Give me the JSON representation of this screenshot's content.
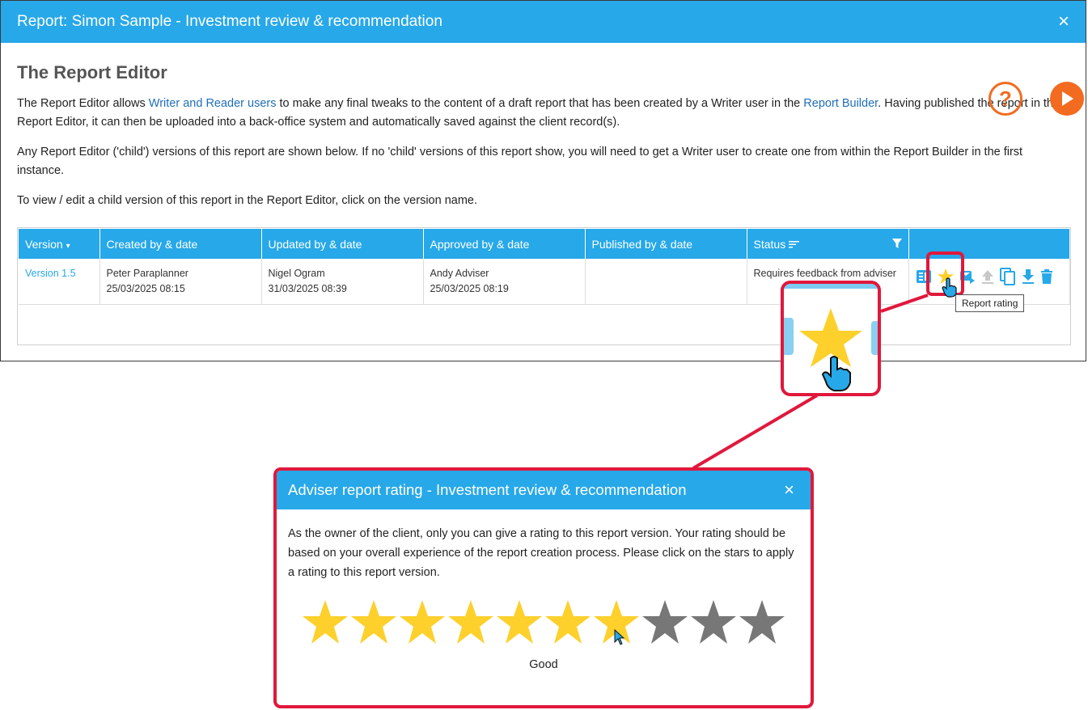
{
  "dialog": {
    "title": "Report: Simon Sample - Investment review & recommendation",
    "close_label": "×"
  },
  "editor": {
    "heading": "The Report Editor",
    "help_label": "?",
    "para1_a": "The Report Editor allows ",
    "para1_link1": "Writer and Reader users",
    "para1_b": " to make any final tweaks to the content of a draft report that has been created by a Writer user in the ",
    "para1_link2": "Report Builder",
    "para1_c": ". Having published the report in the Report Editor, it can then be uploaded into a back-office system and automatically saved against the client record(s).",
    "para2": "Any Report Editor ('child') versions of this report are shown below. If no 'child' versions of this report show, you will need to get a Writer user to create one from within the Report Builder in the first instance.",
    "para3": "To view / edit a child version of this report in the Report Editor, click on the version name."
  },
  "table": {
    "headers": [
      "Version",
      "Created by & date",
      "Updated by & date",
      "Approved by & date",
      "Published by & date",
      "Status"
    ],
    "rows": [
      {
        "version": "Version 1.5",
        "created_by": "Peter Paraplanner",
        "created_date": "25/03/2025 08:15",
        "updated_by": "Nigel Ogram",
        "updated_date": "31/03/2025 08:39",
        "approved_by": "Andy Adviser",
        "approved_date": "25/03/2025 08:19",
        "published_by": "",
        "status": "Requires feedback from adviser"
      }
    ],
    "tooltip": "Report rating"
  },
  "rating_dialog": {
    "title": "Adviser report rating - Investment review & recommendation",
    "close_label": "×",
    "body": "As the owner of the client, only you can give a rating to this report version. Your rating should be based on your overall experience of the report creation process. Please click on the stars to apply a rating to this report version.",
    "rating": 7,
    "max_rating": 10,
    "rating_word": "Good"
  },
  "colors": {
    "accent": "#27a8e8",
    "brand_orange": "#f26b21",
    "highlight": "#e0183c",
    "star_on": "#fdd02c",
    "star_off": "#777777"
  }
}
